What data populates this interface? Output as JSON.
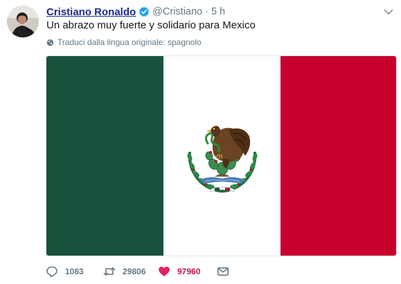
{
  "user": {
    "display_name": "Cristiano Ronaldo",
    "handle": "@Cristiano",
    "separator": "·",
    "time": "5 h"
  },
  "tweet": {
    "text": "Un abrazo muy fuerte y solidario para Mexico"
  },
  "translation": {
    "label": "Traduci dalla lingua originale: spagnolo"
  },
  "media": {
    "description_colors": {
      "green": "#17533c",
      "white": "#ffffff",
      "red": "#c8002c"
    }
  },
  "actions": {
    "replies": "1083",
    "retweets": "29806",
    "likes": "97960"
  },
  "colors": {
    "link": "#1b2a8a",
    "secondary": "#657786",
    "verified": "#1da1f2",
    "like": "#e0245e"
  }
}
